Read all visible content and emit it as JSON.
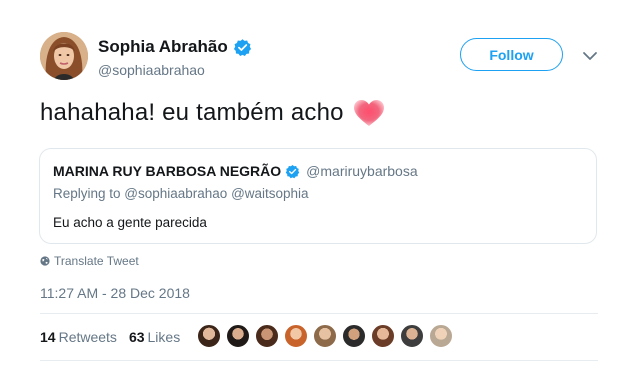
{
  "author": {
    "display_name": "Sophia Abrahão",
    "handle": "@sophiaabrahao",
    "verified": true
  },
  "follow_button": {
    "label": "Follow"
  },
  "tweet": {
    "text": "hahahaha! eu também acho",
    "emoji_icon": "heart-icon"
  },
  "quoted_tweet": {
    "display_name": "MARINA RUY BARBOSA NEGRÃO",
    "handle": "@mariruybarbosa",
    "verified": true,
    "reply_context": "Replying to @sophiaabrahao @waitsophia",
    "text": "Eu acho a gente parecida"
  },
  "translate": {
    "label": "Translate Tweet"
  },
  "timestamp": "11:27 AM - 28 Dec 2018",
  "stats": {
    "retweets_count": "14",
    "retweets_label": "Retweets",
    "likes_count": "63",
    "likes_label": "Likes"
  },
  "colors": {
    "accent": "#1da1f2",
    "text": "#14171a",
    "secondary": "#657786",
    "border": "#e1e8ed"
  }
}
